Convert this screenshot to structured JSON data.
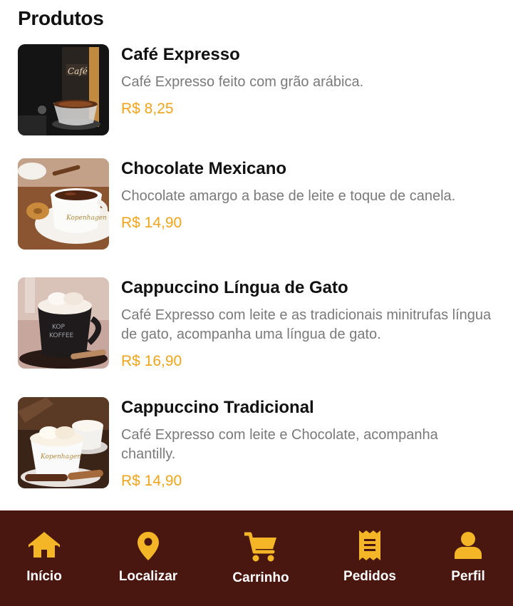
{
  "header": {
    "title": "Produtos"
  },
  "products": [
    {
      "name": "Café Expresso",
      "description": "Café Expresso feito com grão arábica.",
      "price": "R$ 8,25"
    },
    {
      "name": "Chocolate Mexicano",
      "description": "Chocolate amargo a base de leite e toque de canela.",
      "price": "R$ 14,90"
    },
    {
      "name": "Cappuccino Língua de Gato",
      "description": "Café Expresso com leite e as tradicionais minitrufas língua de gato, acompanha uma língua de gato.",
      "price": "R$ 16,90"
    },
    {
      "name": "Cappuccino Tradicional",
      "description": "Café Expresso com leite e Chocolate, acompanha chantilly.",
      "price": "R$ 14,90"
    }
  ],
  "bottom_nav": {
    "items": [
      {
        "label": "Início",
        "icon": "home-icon"
      },
      {
        "label": "Localizar",
        "icon": "map-pin-icon"
      },
      {
        "label": "Carrinho",
        "icon": "cart-icon"
      },
      {
        "label": "Pedidos",
        "icon": "receipt-icon"
      },
      {
        "label": "Perfil",
        "icon": "user-icon"
      }
    ]
  },
  "colors": {
    "accent": "#f0a41b",
    "nav_background": "#4a1610",
    "icon": "#f4b526",
    "description": "#7a7a7a"
  }
}
